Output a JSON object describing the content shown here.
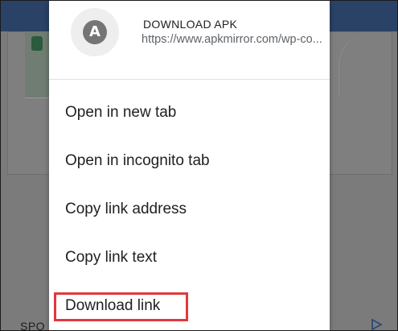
{
  "background": {
    "bottom_text": "SPO",
    "play_icon": "play-triangle-icon"
  },
  "menu": {
    "avatar_letter": "A",
    "link_title": "DOWNLOAD APK",
    "link_url": "https://www.apkmirror.com/wp-co...",
    "items": [
      {
        "label": "Open in new tab"
      },
      {
        "label": "Open in incognito tab"
      },
      {
        "label": "Copy link address"
      },
      {
        "label": "Copy link text"
      },
      {
        "label": "Download link"
      }
    ],
    "highlight_color": "#e0393e"
  }
}
